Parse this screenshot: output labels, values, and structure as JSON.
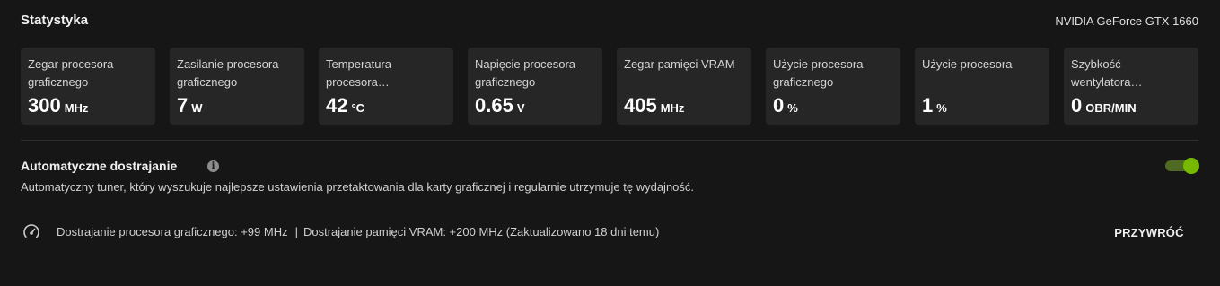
{
  "header": {
    "title": "Statystyka",
    "gpu_name": "NVIDIA GeForce GTX 1660"
  },
  "stats": [
    {
      "label": "Zegar procesora graficznego",
      "value": "300",
      "unit": "MHz"
    },
    {
      "label": "Zasilanie procesora graficznego",
      "value": "7",
      "unit": "W"
    },
    {
      "label": "Temperatura procesora…",
      "value": "42",
      "unit": "°C"
    },
    {
      "label": "Napięcie procesora graficznego",
      "value": "0.65",
      "unit": "V"
    },
    {
      "label": "Zegar pamięci VRAM",
      "value": "405",
      "unit": "MHz"
    },
    {
      "label": "Użycie procesora graficznego",
      "value": "0",
      "unit": "%"
    },
    {
      "label": "Użycie procesora",
      "value": "1",
      "unit": "%"
    },
    {
      "label": "Szybkość wentylatora…",
      "value": "0",
      "unit": "OBR/MIN"
    }
  ],
  "auto_tuning": {
    "title": "Automatyczne dostrajanie",
    "description": "Automatyczny tuner, który wyszukuje najlepsze ustawienia przetaktowania dla karty graficznej i regularnie utrzymuje tę wydajność.",
    "enabled": true,
    "gpu_tuning": "Dostrajanie procesora graficznego: +99 MHz",
    "separator": "|",
    "vram_tuning": "Dostrajanie pamięci VRAM: +200 MHz (Zaktualizowano 18 dni temu)",
    "restore_label": "PRZYWRÓĆ"
  },
  "colors": {
    "background": "#161616",
    "card": "#262626",
    "accent": "#76b900"
  },
  "icons": {
    "info": "info-icon",
    "gauge": "gauge-icon"
  }
}
